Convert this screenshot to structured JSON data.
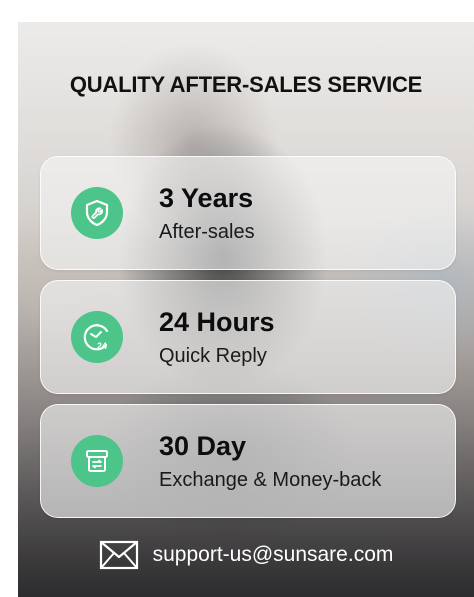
{
  "title": "QUALITY AFTER-SALES SERVICE",
  "features": [
    {
      "heading": "3 Years",
      "subtitle": "After-sales",
      "icon": "shield-wrench-icon"
    },
    {
      "heading": "24 Hours",
      "subtitle": "Quick Reply",
      "icon": "clock-24-icon",
      "icon_text": "24"
    },
    {
      "heading": "30 Day",
      "subtitle": "Exchange & Money-back",
      "icon": "exchange-box-icon"
    }
  ],
  "contact": {
    "icon": "mail-icon",
    "email": "support-us@sunsare.com"
  },
  "colors": {
    "accent": "#4cc48a",
    "text_dark": "#111111",
    "text_light": "#ffffff"
  }
}
